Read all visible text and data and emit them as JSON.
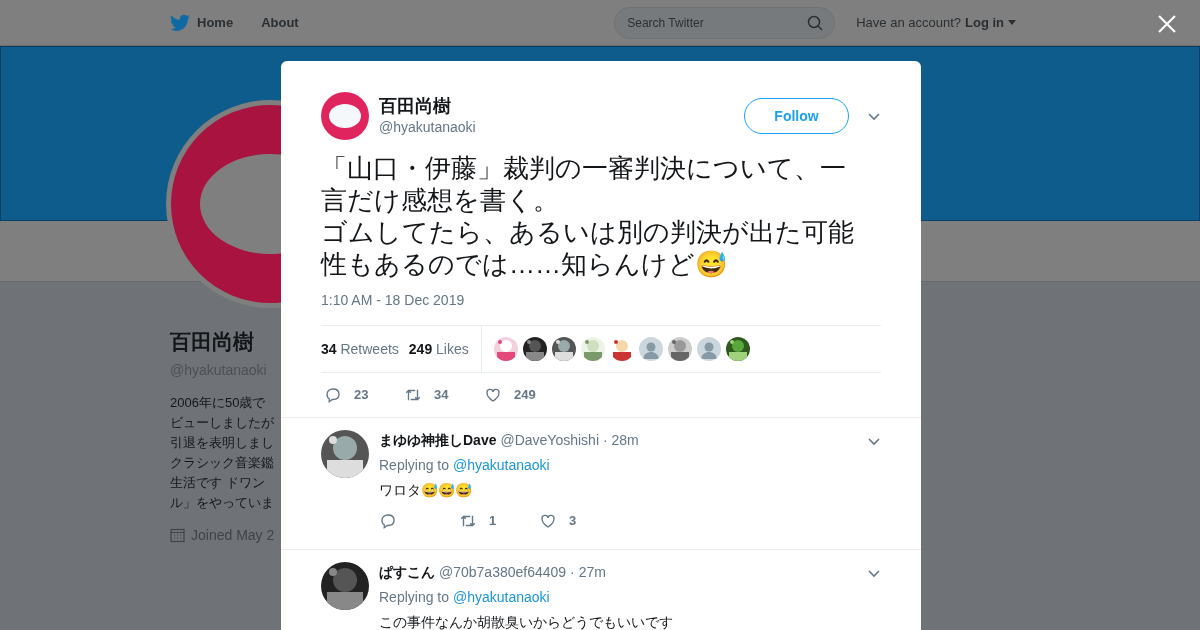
{
  "nav": {
    "items": [
      {
        "label": "Home"
      },
      {
        "label": "About"
      }
    ],
    "search": {
      "placeholder": "Search Twitter"
    },
    "account_prompt": "Have an account?",
    "login": "Log in"
  },
  "profile": {
    "name": "百田尚樹",
    "handle": "@hyakutanaoki",
    "bio_lines": [
      "2006年に50歳で",
      "ビューしましたが",
      "引退を表明しまし",
      "クラシック音楽鑑",
      "生活です ドワン",
      "ル」をやっていま"
    ],
    "joined": "Joined May 2"
  },
  "tweet": {
    "name": "百田尚樹",
    "handle": "@hyakutanaoki",
    "follow": "Follow",
    "lines": [
      "「山口・伊藤」裁判の一審判決について、一",
      "言だけ感想を書く。",
      "ゴムしてたら、あるいは別の判決が出た可能",
      "性もあるのでは……知らんけど😅"
    ],
    "time": "1:10 AM - 18 Dec 2019",
    "retweets": {
      "count": "34",
      "label": "Retweets"
    },
    "likes": {
      "count": "249",
      "label": "Likes"
    },
    "likers": [
      {
        "kind": "picture"
      },
      {
        "kind": "picture"
      },
      {
        "kind": "picture"
      },
      {
        "kind": "picture"
      },
      {
        "kind": "picture"
      },
      {
        "kind": "default"
      },
      {
        "kind": "picture"
      },
      {
        "kind": "default"
      },
      {
        "kind": "picture"
      }
    ],
    "actions": [
      {
        "kind": "reply",
        "count": "23"
      },
      {
        "kind": "retweet",
        "count": "34"
      },
      {
        "kind": "like",
        "count": "249"
      }
    ]
  },
  "replies": [
    {
      "name": "まゆゆ神推しDave",
      "handle": "@DaveYoshishi",
      "time": "· 28m",
      "replying_label": "Replying to",
      "replying_to": "@hyakutanaoki",
      "text": "ワロタ😅😅😅",
      "actions": [
        {
          "kind": "reply"
        },
        {
          "kind": "retweet",
          "count": "1"
        },
        {
          "kind": "like",
          "count": "3"
        }
      ]
    },
    {
      "name": "ぱすこん",
      "handle": "@70b7a380ef64409",
      "time": "· 27m",
      "replying_label": "Replying to",
      "replying_to": "@hyakutanaoki",
      "text": "この事件なんか胡散臭いからどうでもいいです"
    }
  ]
}
